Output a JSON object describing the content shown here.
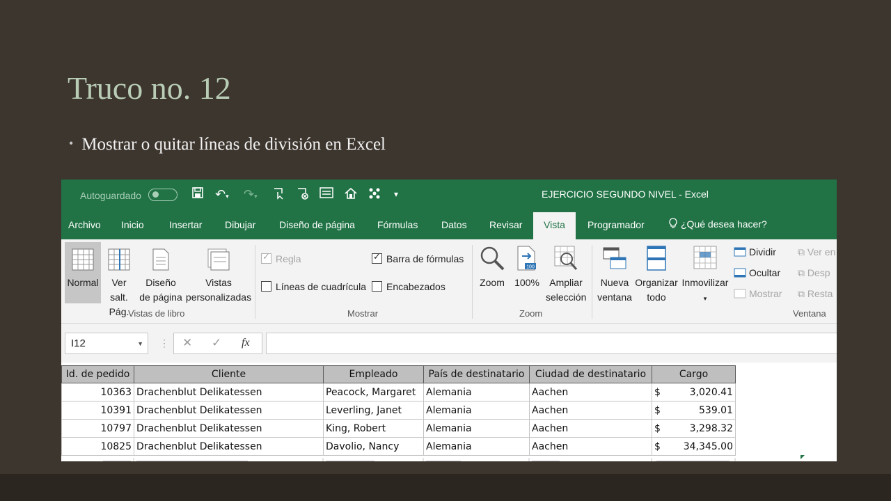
{
  "slide": {
    "title": "Truco no. 12",
    "bullet": "Mostrar o quitar líneas de división en Excel"
  },
  "excel": {
    "quick_access": {
      "autosave_label": "Autoguardado",
      "icons": [
        "save-icon",
        "undo-icon",
        "redo-icon",
        "touch-mode-icon",
        "clear-icon",
        "form-icon",
        "home-icon",
        "shapes-icon",
        "customize-qat-icon"
      ]
    },
    "window_title": "EJERCICIO SEGUNDO NIVEL  -  Excel",
    "tabs": [
      "Archivo",
      "Inicio",
      "Insertar",
      "Dibujar",
      "Diseño de página",
      "Fórmulas",
      "Datos",
      "Revisar",
      "Vista",
      "Programador"
    ],
    "active_tab": "Vista",
    "tell_me": "¿Qué desea hacer?",
    "ribbon": {
      "vistas": {
        "normal": "Normal",
        "ver_salt_1": "Ver salt.",
        "ver_salt_2": "Pág.",
        "diseno_1": "Diseño",
        "diseno_2": "de página",
        "vistas_pers_1": "Vistas",
        "vistas_pers_2": "personalizadas",
        "group": "Vistas de libro"
      },
      "mostrar": {
        "regla": "Regla",
        "barra_formulas": "Barra de fórmulas",
        "lineas": "Líneas de cuadrícula",
        "encabezados": "Encabezados",
        "group": "Mostrar"
      },
      "zoom": {
        "zoom": "Zoom",
        "cien": "100%",
        "cien_badge": "100",
        "ampliar_1": "Ampliar",
        "ampliar_2": "selección",
        "group": "Zoom"
      },
      "ventana": {
        "nueva_1": "Nueva",
        "nueva_2": "ventana",
        "organizar_1": "Organizar",
        "organizar_2": "todo",
        "inmovilizar": "Inmovilizar",
        "dividir": "Dividir",
        "ocultar": "Ocultar",
        "mostrar": "Mostrar",
        "ver_en": "Ver en",
        "desp": "Desp",
        "resta": "Resta",
        "group": "Ventana"
      }
    },
    "formula_bar": {
      "name_box": "I12",
      "fx": "fx",
      "value": ""
    },
    "table": {
      "headers": [
        "Id. de pedido",
        "Cliente",
        "Empleado",
        "País de destinatario",
        "Ciudad de destinatario",
        "Cargo"
      ],
      "rows": [
        [
          "10363",
          "Drachenblut Delikatessen",
          "Peacock, Margaret",
          "Alemania",
          "Aachen",
          "3,020.41"
        ],
        [
          "10391",
          "Drachenblut Delikatessen",
          "Leverling, Janet",
          "Alemania",
          "Aachen",
          "539.01"
        ],
        [
          "10797",
          "Drachenblut Delikatessen",
          "King, Robert",
          "Alemania",
          "Aachen",
          "3,298.32"
        ],
        [
          "10825",
          "Drachenblut Delikatessen",
          "Davolio, Nancy",
          "Alemania",
          "Aachen",
          "34,345.00"
        ]
      ],
      "currency_symbol": "$"
    },
    "colors": {
      "excel_green": "#217346",
      "ribbon_bg": "#f3f3f3",
      "slide_bg": "#3d362f",
      "title_color": "#b9cdb6"
    }
  }
}
